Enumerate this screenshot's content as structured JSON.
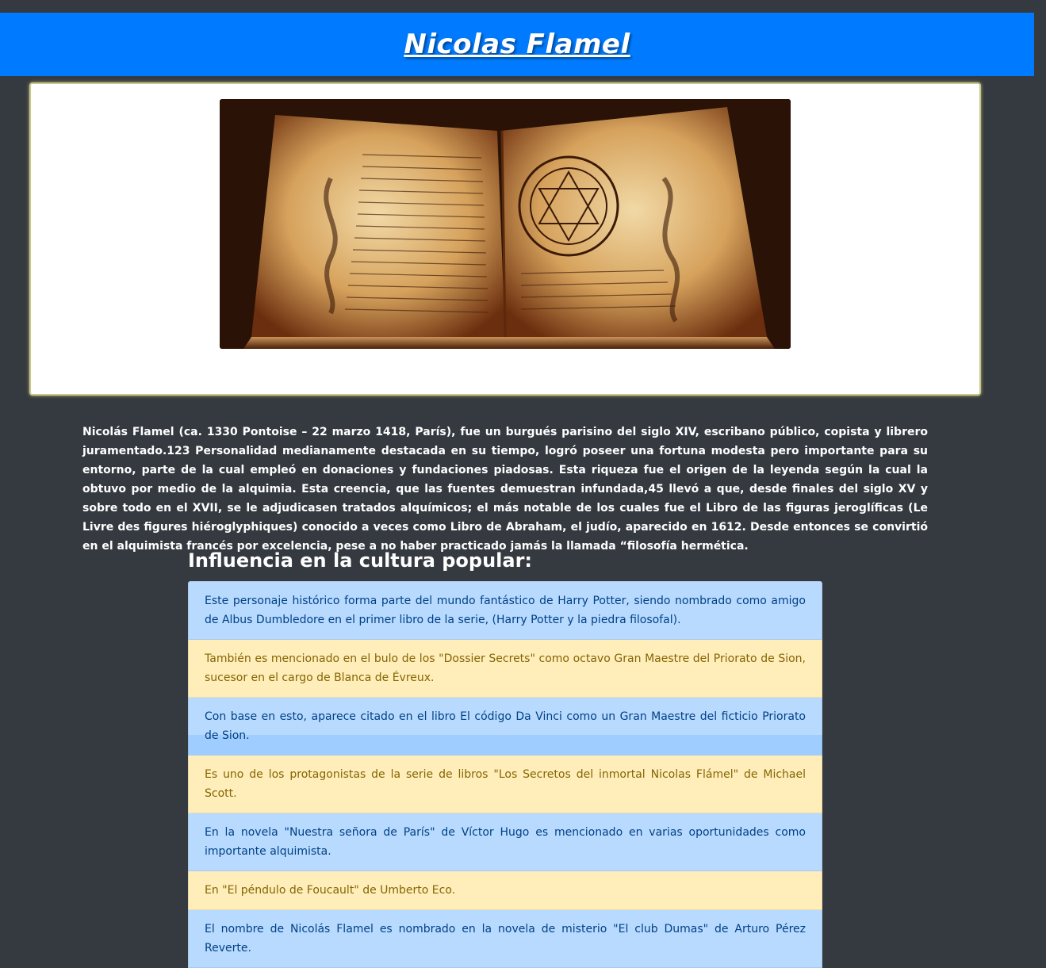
{
  "header": {
    "title": "Nicolas Flamel",
    "color": "#007bff"
  },
  "hero_image": {
    "alt": "libro antiguo de alquimia"
  },
  "bio": "Nicolás Flamel (ca. 1330 Pontoise – 22 marzo 1418, París), fue un burgués parisino del siglo XIV, escribano público, copista y librero juramentado.123 Personalidad medianamente destacada en su tiempo, logró poseer una fortuna modesta pero importante para su entorno, parte de la cual empleó en donaciones y fundaciones piadosas. Esta riqueza fue el origen de la leyenda según la cual la obtuvo por medio de la alquimia. Esta creencia, que las fuentes demuestran infundada,45 llevó a que, desde finales del siglo XV y sobre todo en el XVII, se le adjudicasen tratados alquímicos; el más notable de los cuales fue el Libro de las figuras jeroglíficas (Le Livre des figures hiéroglyphiques) conocido a veces como Libro de Abraham, el judío, aparecido en 1612. Desde entonces se convirtió en el alquimista francés por excelencia, pese a no haber practicado jamás la llamada “filosofía hermética.",
  "influence": {
    "title": "Influencia en la cultura popular:",
    "items": [
      {
        "text": "Este personaje histórico forma parte del mundo fantástico de Harry Potter, siendo nombrado como amigo de Albus Dumbledore en el primer libro de la serie, (Harry Potter y la piedra filosofal).",
        "style": "info"
      },
      {
        "text": "También es mencionado en el bulo de los \"Dossier Secrets\" como octavo Gran Maestre del Priorato de Sion, sucesor en el cargo de Blanca de Évreux.",
        "style": "warn"
      },
      {
        "text": "Con base en esto, aparece citado en el libro El código Da Vinci como un Gran Maestre del ficticio Priorato de Sion.",
        "style": "info"
      },
      {
        "text": "Es uno de los protagonistas de la serie de libros \"Los Secretos del inmortal Nicolas Flámel\" de Michael Scott.",
        "style": "warn"
      },
      {
        "text": "En la novela \"Nuestra señora de París\" de Víctor Hugo es mencionado en varias oportunidades como importante alquimista.",
        "style": "info"
      },
      {
        "text": "En \"El péndulo de Foucault\" de Umberto Eco.",
        "style": "warn"
      },
      {
        "text": "El nombre de Nicolás Flamel es nombrado en la novela de misterio \"El club Dumas\" de Arturo Pérez Reverte.",
        "style": "info"
      }
    ]
  },
  "colors": {
    "background": "#343a40",
    "info_bg": "#b8daff",
    "info_text": "#004085",
    "warn_bg": "#ffeeba",
    "warn_text": "#856404"
  }
}
